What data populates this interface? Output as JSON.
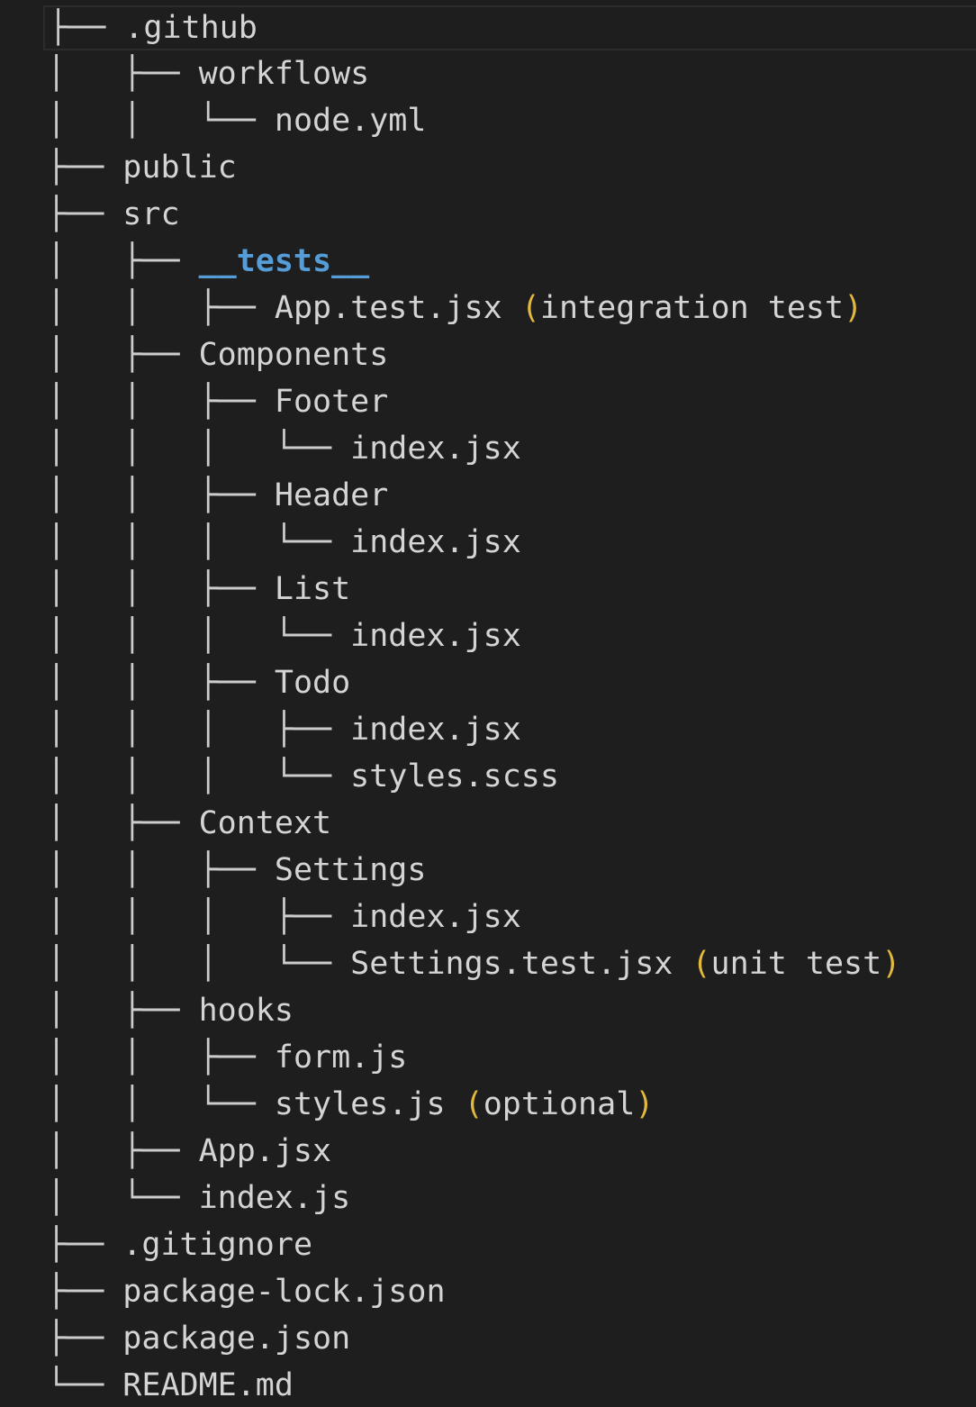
{
  "colors": {
    "background": "#1e1e1e",
    "text": "#d4d4d4",
    "heading": "#569cd6",
    "bracket": "#e2b93d"
  },
  "tree": [
    {
      "prefix": "├── ",
      "name": ".github",
      "current": true
    },
    {
      "prefix": "│   ├── ",
      "name": "workflows"
    },
    {
      "prefix": "│   │   └── ",
      "name": "node.yml"
    },
    {
      "prefix": "├── ",
      "name": "public"
    },
    {
      "prefix": "├── ",
      "name": "src"
    },
    {
      "prefix": "│   ├── ",
      "name": "__tests__",
      "style": "heading"
    },
    {
      "prefix": "│   │   ├── ",
      "name": "App.test.jsx",
      "note": "integration test"
    },
    {
      "prefix": "│   ├── ",
      "name": "Components"
    },
    {
      "prefix": "│   │   ├── ",
      "name": "Footer"
    },
    {
      "prefix": "│   │   │   └── ",
      "name": "index.jsx"
    },
    {
      "prefix": "│   │   ├── ",
      "name": "Header"
    },
    {
      "prefix": "│   │   │   └── ",
      "name": "index.jsx"
    },
    {
      "prefix": "│   │   ├── ",
      "name": "List"
    },
    {
      "prefix": "│   │   │   └── ",
      "name": "index.jsx"
    },
    {
      "prefix": "│   │   ├── ",
      "name": "Todo"
    },
    {
      "prefix": "│   │   │   ├── ",
      "name": "index.jsx"
    },
    {
      "prefix": "│   │   │   └── ",
      "name": "styles.scss"
    },
    {
      "prefix": "│   ├── ",
      "name": "Context"
    },
    {
      "prefix": "│   │   ├── ",
      "name": "Settings"
    },
    {
      "prefix": "│   │   │   ├── ",
      "name": "index.jsx"
    },
    {
      "prefix": "│   │   │   └── ",
      "name": "Settings.test.jsx",
      "note": "unit test"
    },
    {
      "prefix": "│   ├── ",
      "name": "hooks"
    },
    {
      "prefix": "│   │   ├── ",
      "name": "form.js"
    },
    {
      "prefix": "│   │   └── ",
      "name": "styles.js",
      "note": "optional"
    },
    {
      "prefix": "│   ├── ",
      "name": "App.jsx"
    },
    {
      "prefix": "│   └── ",
      "name": "index.js"
    },
    {
      "prefix": "├── ",
      "name": ".gitignore"
    },
    {
      "prefix": "├── ",
      "name": "package-lock.json"
    },
    {
      "prefix": "├── ",
      "name": "package.json"
    },
    {
      "prefix": "└── ",
      "name": "README.md"
    }
  ]
}
